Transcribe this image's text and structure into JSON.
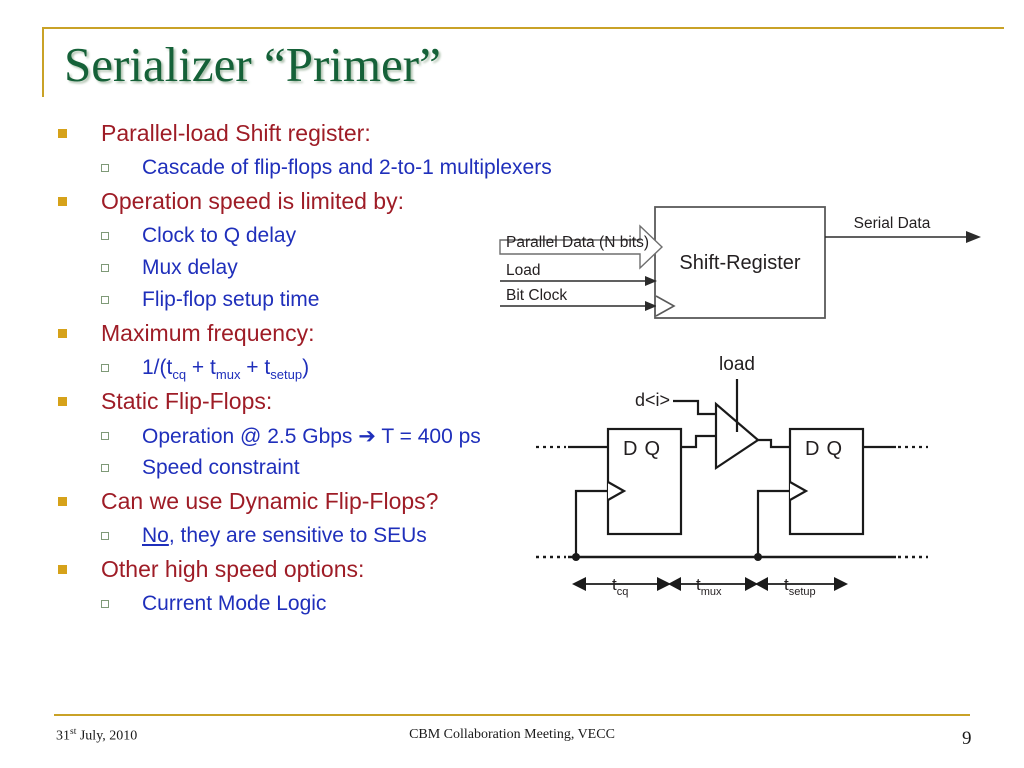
{
  "slide": {
    "title": "Serializer “Primer”",
    "title_color": "#156138",
    "accent_rule_color": "#c9a227",
    "level1_color": "#9e1c26",
    "level2_color": "#1f2fbb",
    "level1_marker_color": "#d6a21a",
    "level2_marker_border_color": "#7f9a78",
    "background": "#ffffff"
  },
  "bullets": [
    {
      "level": 1,
      "text": "Parallel-load  Shift register:"
    },
    {
      "level": 2,
      "text": "Cascade of flip-flops and 2-to-1 multiplexers"
    },
    {
      "level": 1,
      "text": "Operation speed is limited by:"
    },
    {
      "level": 2,
      "text": "Clock to Q delay"
    },
    {
      "level": 2,
      "text": "Mux delay"
    },
    {
      "level": 2,
      "text": "Flip-flop setup time"
    },
    {
      "level": 1,
      "text": "Maximum frequency:"
    },
    {
      "level": 2,
      "text": "1/(tcq + tmux + tsetup)",
      "formula": true
    },
    {
      "level": 1,
      "text": "Static Flip-Flops:"
    },
    {
      "level": 2,
      "text": "Operation @ 2.5 Gbps ➔ T = 400 ps",
      "has_arrow": true
    },
    {
      "level": 2,
      "text": "Speed constraint"
    },
    {
      "level": 1,
      "text": "Can we use Dynamic Flip-Flops?"
    },
    {
      "level": 2,
      "text": "No, they are sensitive to SEUs",
      "underline_prefix": "No"
    },
    {
      "level": 1,
      "text": "Other high speed options:"
    },
    {
      "level": 2,
      "text": "Current Mode Logic"
    }
  ],
  "bullet_text": {
    "b0": "Parallel-load  Shift register:",
    "b1": "Cascade of flip-flops and 2-to-1 multiplexers",
    "b2": "Operation speed is limited by:",
    "b3": "Clock to Q delay",
    "b4": "Mux delay",
    "b5": "Flip-flop setup time",
    "b6": "Maximum frequency:",
    "b8": "Static Flip-Flops:",
    "b10": "Speed constraint",
    "b11": "Can we use Dynamic Flip-Flops?",
    "b13": "Other high speed options:",
    "b14": "Current Mode Logic"
  },
  "formula": {
    "open": "1/(t",
    "sub1": "cq",
    "plus1": " + t",
    "sub2": "mux",
    "plus2": " + t",
    "sub3": "setup",
    "close": ")"
  },
  "operation_line": {
    "before": "Operation @ 2.5 Gbps ",
    "arrow": "➔",
    "after": " T = 400 ps"
  },
  "seu_line": {
    "underlined": "No",
    "rest": ", they are sensitive to SEUs"
  },
  "diagram_shift_register": {
    "block_label": "Shift-Register",
    "input_bus_label": "Parallel Data (N bits)",
    "input_load_label": "Load",
    "input_clock_label": "Bit Clock",
    "output_label": "Serial Data",
    "line_color": "#231f20"
  },
  "diagram_flipflops": {
    "select_label": "load",
    "data_in_label": "d<i>",
    "ff_left_d": "D",
    "ff_left_q": "Q",
    "ff_right_d": "D",
    "ff_right_q": "Q",
    "timing": [
      {
        "name": "t",
        "sub": "cq"
      },
      {
        "name": "t",
        "sub": "mux"
      },
      {
        "name": "t",
        "sub": "setup"
      }
    ],
    "timing_labels": {
      "t1_base": "t",
      "t1_sub": "cq",
      "t2_base": "t",
      "t2_sub": "mux",
      "t3_base": "t",
      "t3_sub": "setup"
    },
    "line_color": "#231f20"
  },
  "footer": {
    "date_main": "31",
    "date_sup": "st",
    "date_rest": " July, 2010",
    "center": "CBM Collaboration Meeting, VECC",
    "page": "9"
  }
}
